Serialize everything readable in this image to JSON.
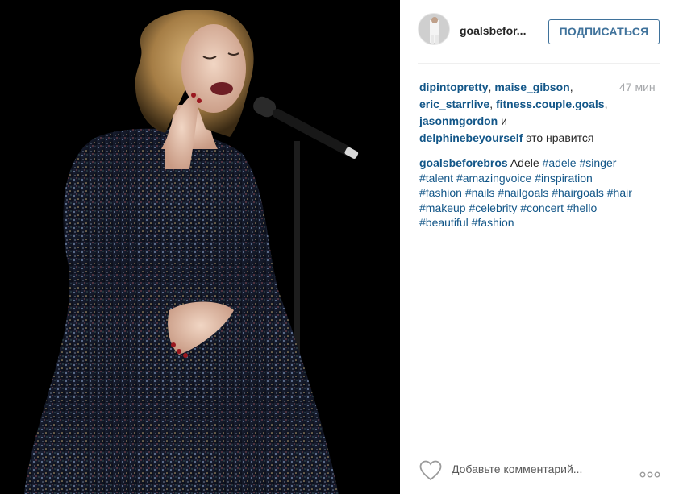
{
  "post": {
    "username": "goalsbefor...",
    "follow_label": "ПОДПИСАТЬСЯ",
    "time_ago": "47 мин",
    "likes": {
      "users": [
        "dipintopretty",
        "maise_gibson",
        "eric_starrlive",
        "fitness.couple.goals",
        "jasonmgordon",
        "delphinebeyourself"
      ],
      "sep": ", ",
      "and_word": " и",
      "suffix": " это нравится"
    },
    "caption": {
      "author": "goalsbeforebros",
      "text": " Adele ",
      "hashtags": [
        "#adele",
        "#singer",
        "#talent",
        "#amazingvoice",
        "#inspiration",
        "#fashion",
        "#nails",
        "#nailgoals",
        "#hairgoals",
        "#hair",
        "#makeup",
        "#celebrity",
        "#concert",
        "#hello",
        "#beautiful",
        "#fashion"
      ]
    },
    "comment_placeholder": "Добавьте комментарий...",
    "more_label": "ooo"
  },
  "icons": {
    "heart": "heart-icon",
    "more": "more-options-icon"
  },
  "colors": {
    "link": "#125688",
    "follow": "#3f729b",
    "muted": "#a5a7aa",
    "text": "#262626"
  }
}
